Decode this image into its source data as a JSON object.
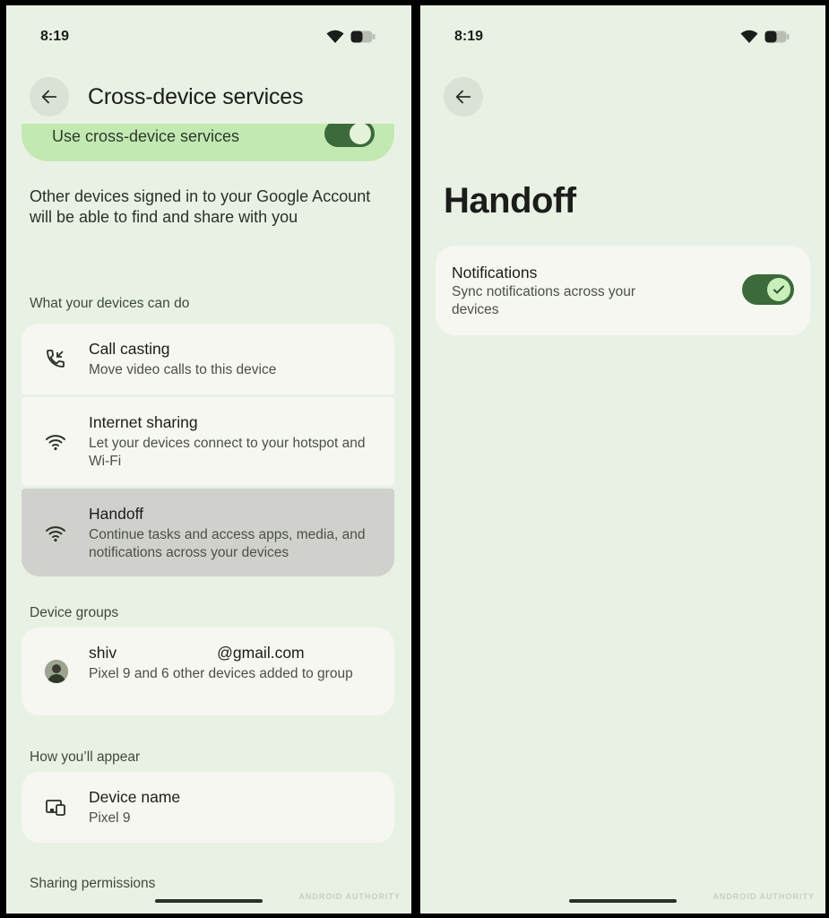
{
  "left_screen": {
    "status": {
      "time": "8:19"
    },
    "header": {
      "title": "Cross-device services"
    },
    "master_switch": {
      "label": "Use cross-device services",
      "enabled": true
    },
    "description": "Other devices signed in to your Google Account will be able to find and share with you",
    "sections": {
      "capabilities": "What your devices can do",
      "device_groups": "Device groups",
      "appearance": "How you’ll appear",
      "sharing": "Sharing permissions"
    },
    "capabilities": [
      {
        "title": "Call casting",
        "subtitle": "Move video calls to this device",
        "icon": "call-casting-icon"
      },
      {
        "title": "Internet sharing",
        "subtitle": "Let your devices connect to your hotspot and Wi-Fi",
        "icon": "wifi-icon"
      },
      {
        "title": "Handoff",
        "subtitle": "Continue tasks and access apps, media, and notifications across your devices",
        "icon": "wifi-icon",
        "selected": true
      }
    ],
    "device_group": {
      "email_prefix": "shiv",
      "email_suffix": "@gmail.com",
      "subtitle": "Pixel 9 and 6 other devices added to group"
    },
    "device_name": {
      "title": "Device name",
      "value": "Pixel 9"
    },
    "watermark": "ANDROID AUTHORITY"
  },
  "right_screen": {
    "status": {
      "time": "8:19"
    },
    "title": "Handoff",
    "notifications": {
      "title": "Notifications",
      "subtitle": "Sync notifications across your devices",
      "enabled": true
    },
    "watermark": "ANDROID AUTHORITY"
  },
  "colors": {
    "background": "#e9f1e4",
    "card": "#f6f7f1",
    "selected_card": "#d0d1cc",
    "master_card": "#c3e9b3",
    "toggle_track": "#3c6a3b",
    "toggle_knob": "#c8efba"
  }
}
